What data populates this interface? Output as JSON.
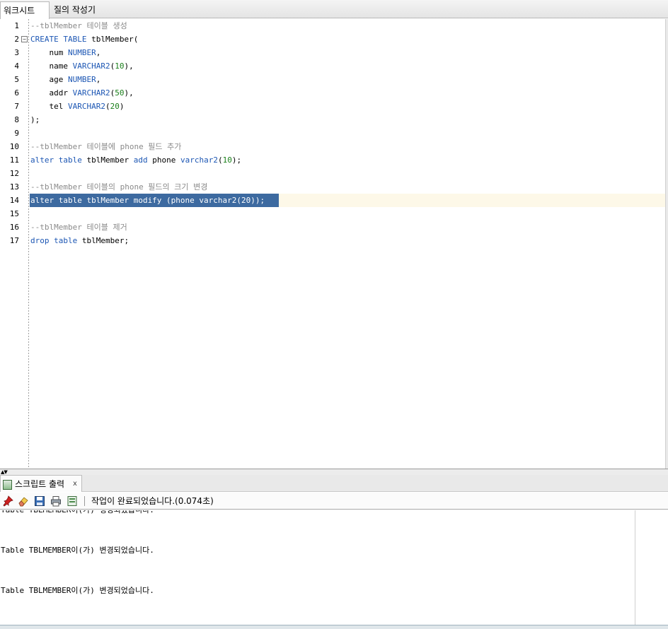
{
  "tabs": [
    "워크시트",
    "질의 작성기"
  ],
  "editor": {
    "line_numbers": [
      "1",
      "2",
      "3",
      "4",
      "5",
      "6",
      "7",
      "8",
      "9",
      "10",
      "11",
      "12",
      "13",
      "14",
      "15",
      "16",
      "17"
    ],
    "current_line": 14,
    "lines": [
      {
        "n": 1,
        "tokens": [
          {
            "t": "--tblMember 테이블 생성",
            "c": "cmt"
          }
        ]
      },
      {
        "n": 2,
        "tokens": [
          {
            "t": "CREATE",
            "c": "kw"
          },
          {
            "t": " "
          },
          {
            "t": "TABLE",
            "c": "kw"
          },
          {
            "t": " tblMember("
          }
        ]
      },
      {
        "n": 3,
        "tokens": [
          {
            "t": "    num "
          },
          {
            "t": "NUMBER",
            "c": "kw"
          },
          {
            "t": ","
          }
        ]
      },
      {
        "n": 4,
        "tokens": [
          {
            "t": "    name "
          },
          {
            "t": "VARCHAR2",
            "c": "kw"
          },
          {
            "t": "("
          },
          {
            "t": "10",
            "c": "num"
          },
          {
            "t": "),"
          }
        ]
      },
      {
        "n": 5,
        "tokens": [
          {
            "t": "    age "
          },
          {
            "t": "NUMBER",
            "c": "kw"
          },
          {
            "t": ","
          }
        ]
      },
      {
        "n": 6,
        "tokens": [
          {
            "t": "    addr "
          },
          {
            "t": "VARCHAR2",
            "c": "kw"
          },
          {
            "t": "("
          },
          {
            "t": "50",
            "c": "num"
          },
          {
            "t": "),"
          }
        ]
      },
      {
        "n": 7,
        "tokens": [
          {
            "t": "    tel "
          },
          {
            "t": "VARCHAR2",
            "c": "kw"
          },
          {
            "t": "("
          },
          {
            "t": "20",
            "c": "num"
          },
          {
            "t": ")"
          }
        ]
      },
      {
        "n": 8,
        "tokens": [
          {
            "t": ");"
          }
        ]
      },
      {
        "n": 9,
        "tokens": []
      },
      {
        "n": 10,
        "tokens": [
          {
            "t": "--tblMember 테이블에 phone 필드 추가",
            "c": "cmt"
          }
        ]
      },
      {
        "n": 11,
        "tokens": [
          {
            "t": "alter",
            "c": "kw"
          },
          {
            "t": " "
          },
          {
            "t": "table",
            "c": "kw"
          },
          {
            "t": " tblMember "
          },
          {
            "t": "add",
            "c": "kw"
          },
          {
            "t": " phone "
          },
          {
            "t": "varchar2",
            "c": "kw"
          },
          {
            "t": "("
          },
          {
            "t": "10",
            "c": "num"
          },
          {
            "t": ");"
          }
        ]
      },
      {
        "n": 12,
        "tokens": []
      },
      {
        "n": 13,
        "tokens": [
          {
            "t": "--tblMember 테이블의 phone 필드의 크기 변경",
            "c": "cmt"
          }
        ]
      },
      {
        "n": 14,
        "tokens": [
          {
            "t": "alter table tblMember modify (phone varchar2(20));"
          }
        ],
        "selected": true
      },
      {
        "n": 15,
        "tokens": []
      },
      {
        "n": 16,
        "tokens": [
          {
            "t": "--tblMember 테이블 제거",
            "c": "cmt"
          }
        ]
      },
      {
        "n": 17,
        "tokens": [
          {
            "t": "drop",
            "c": "kw"
          },
          {
            "t": " "
          },
          {
            "t": "table",
            "c": "kw"
          },
          {
            "t": " tblMember;"
          }
        ]
      }
    ]
  },
  "output_panel": {
    "tab_label": "스크립트 출력",
    "tab_close": "x",
    "toolbar_icons": [
      "pin-icon",
      "eraser-icon",
      "save-icon",
      "print-icon",
      "open-file-icon"
    ],
    "status": "작업이 완료되었습니다.(0.074초)",
    "lines": [
      "Table TBLMEMBER이(가) 생성되었습니다.",
      "",
      "",
      "Table TBLMEMBER이(가) 변경되었습니다.",
      "",
      "",
      "Table TBLMEMBER이(가) 변경되었습니다."
    ]
  },
  "colors": {
    "keyword": "#1d57b4",
    "comment": "#8a8a8a",
    "number": "#1a7f1a",
    "selection": "#3d6aa0",
    "current_line": "#fdf8e8"
  }
}
